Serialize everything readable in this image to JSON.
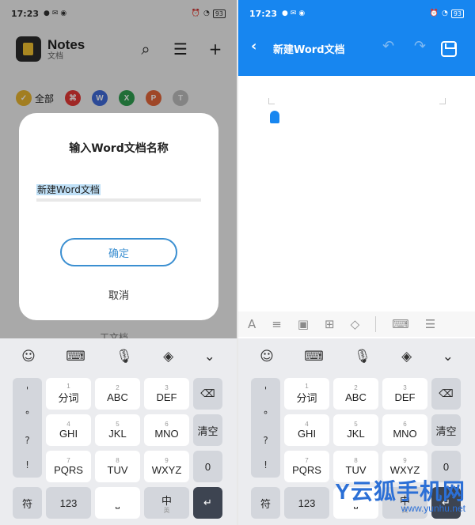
{
  "left": {
    "status": {
      "time": "17:23",
      "battery": "93"
    },
    "app": {
      "title": "Notes",
      "subtitle": "文档"
    },
    "filters": [
      {
        "label": "全部",
        "color": "#e8b530"
      },
      {
        "label": "",
        "color": "#e53935",
        "glyph": "⌘"
      },
      {
        "label": "",
        "color": "#3f6bd8",
        "glyph": "W"
      },
      {
        "label": "",
        "color": "#2e9e4f",
        "glyph": "X"
      },
      {
        "label": "",
        "color": "#e4663a",
        "glyph": "P"
      },
      {
        "label": "",
        "color": "#bdbdbd",
        "glyph": "T"
      }
    ],
    "background_text": "工文档",
    "dialog": {
      "title": "输入Word文档名称",
      "input_value": "新建Word文档",
      "ok": "确定",
      "cancel": "取消"
    }
  },
  "right": {
    "status": {
      "time": "17:23",
      "battery": "93"
    },
    "title": "新建Word文档"
  },
  "keyboard": {
    "symbols": [
      "'",
      "°",
      "?",
      "!"
    ],
    "row1": [
      {
        "main": "分词",
        "sub": "1"
      },
      {
        "main": "ABC",
        "sub": "2"
      },
      {
        "main": "DEF",
        "sub": "3"
      }
    ],
    "row2": [
      {
        "main": "GHI",
        "sub": "4"
      },
      {
        "main": "JKL",
        "sub": "5"
      },
      {
        "main": "MNO",
        "sub": "6"
      }
    ],
    "row3": [
      {
        "main": "PQRS",
        "sub": "7"
      },
      {
        "main": "TUV",
        "sub": "8"
      },
      {
        "main": "WXYZ",
        "sub": "9"
      }
    ],
    "side": {
      "clear": "清空",
      "zero": "0"
    },
    "bottom": {
      "symbol": "符",
      "numbers": "123",
      "lang": "中",
      "lang_sub": "英"
    }
  },
  "watermark": {
    "main": "云狐手机网",
    "letter": "Y",
    "url": "www.yunhu.net"
  }
}
